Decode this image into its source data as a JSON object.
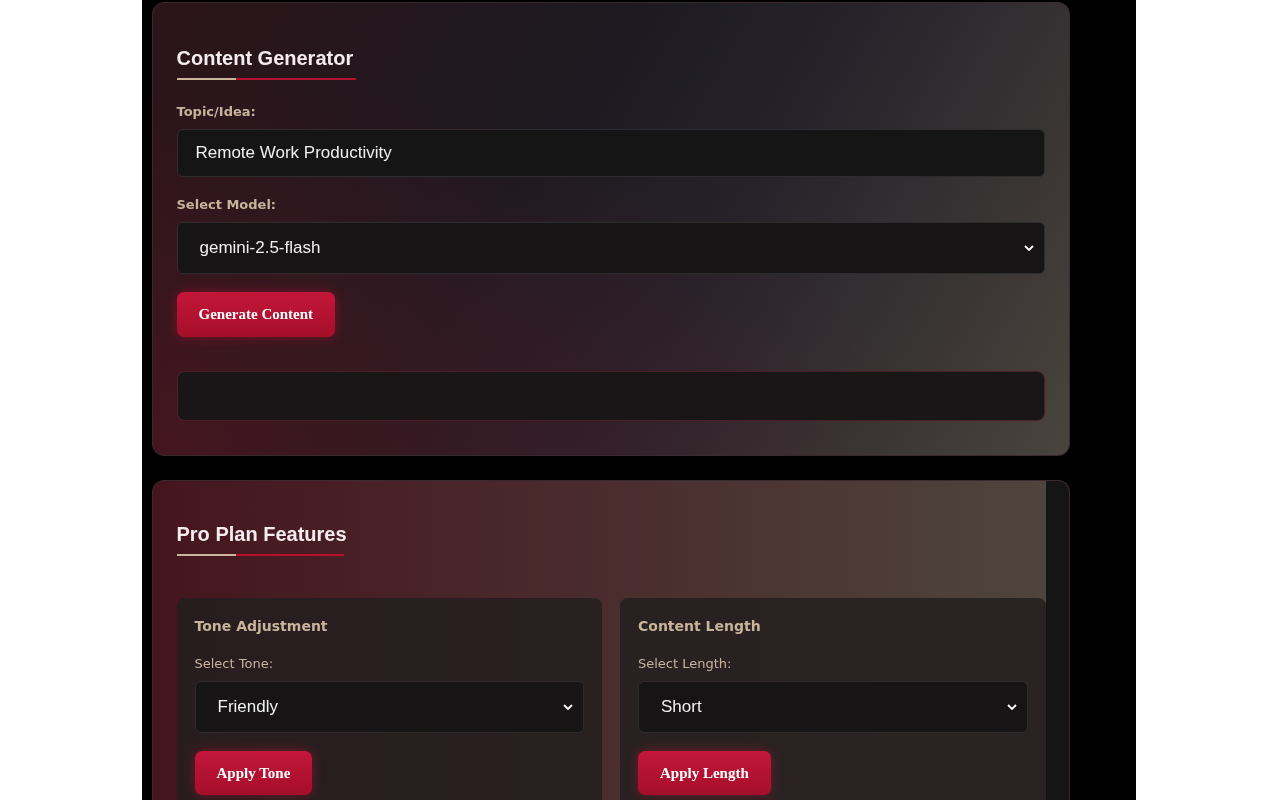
{
  "generator": {
    "title": "Content Generator",
    "topic": {
      "label": "Topic/Idea:",
      "value": "Remote Work Productivity"
    },
    "model": {
      "label": "Select Model:",
      "value": "gemini-2.5-flash"
    },
    "button": "Generate Content"
  },
  "pro": {
    "title": "Pro Plan Features",
    "features": [
      {
        "title": "Tone Adjustment",
        "label": "Select Tone:",
        "value": "Friendly",
        "button": "Apply Tone"
      },
      {
        "title": "Content Length",
        "label": "Select Length:",
        "value": "Short",
        "button": "Apply Length"
      }
    ]
  }
}
